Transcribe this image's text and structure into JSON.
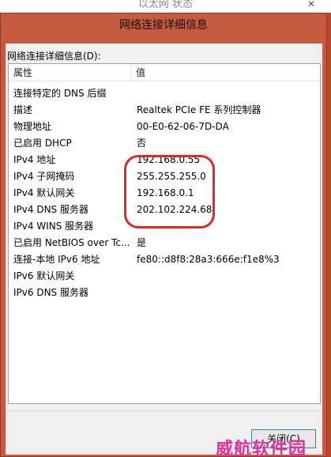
{
  "background_window": {
    "title": "以太网 状态",
    "close_glyph": "✕"
  },
  "dialog": {
    "title": "网络连接详细信息",
    "caption": "网络连接详细信息(D):",
    "columns": {
      "property": "属性",
      "value": "值"
    },
    "rows": [
      {
        "property": "连接特定的 DNS 后缀",
        "value": ""
      },
      {
        "property": "描述",
        "value": "Realtek PCIe FE 系列控制器"
      },
      {
        "property": "物理地址",
        "value": "00-E0-62-06-7D-DA"
      },
      {
        "property": "已启用 DHCP",
        "value": "否"
      },
      {
        "property": "IPv4 地址",
        "value": "192.168.0.55"
      },
      {
        "property": "IPv4 子网掩码",
        "value": "255.255.255.0"
      },
      {
        "property": "IPv4 默认网关",
        "value": "192.168.0.1"
      },
      {
        "property": "IPv4 DNS 服务器",
        "value": "202.102.224.68"
      },
      {
        "property": "IPv4 WINS 服务器",
        "value": ""
      },
      {
        "property": "已启用 NetBIOS over Tc...",
        "value": "是"
      },
      {
        "property": "连接-本地 IPv6 地址",
        "value": "fe80::d8f8:28a3:666e:f1e8%3"
      },
      {
        "property": "IPv6 默认网关",
        "value": ""
      },
      {
        "property": "IPv6 DNS 服务器",
        "value": ""
      }
    ],
    "close_label": "关闭(C)"
  },
  "watermark": "威航软件园",
  "colors": {
    "title_bar": "#c45a3e",
    "highlight_ring": "#e02828",
    "watermark": "#e0309a"
  }
}
